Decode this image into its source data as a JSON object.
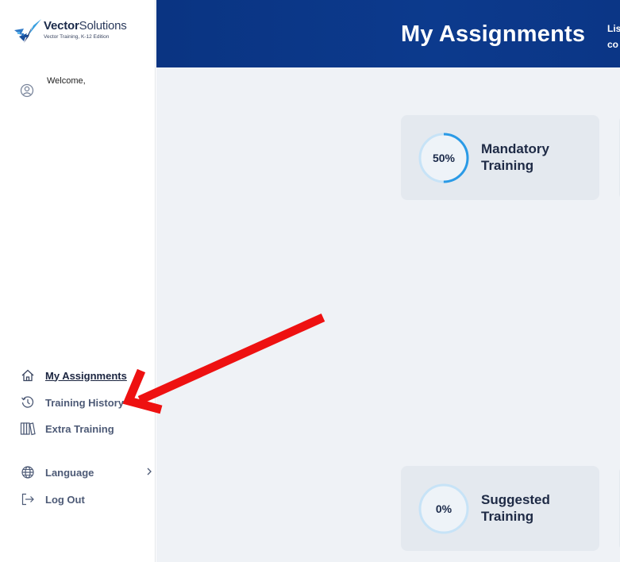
{
  "logo": {
    "brand_bold": "Vector",
    "brand_light": "Solutions",
    "edition": "Vector Training, K-12 Edition"
  },
  "sidebar": {
    "welcome": "Welcome,",
    "nav": [
      {
        "label": "My Assignments",
        "icon": "home-icon",
        "active": true
      },
      {
        "label": "Training History",
        "icon": "history-icon"
      },
      {
        "label": "Extra Training",
        "icon": "library-icon"
      }
    ],
    "language": "Language",
    "logout": "Log Out"
  },
  "header": {
    "title": "My Assignments",
    "sub_line1": "Lis",
    "sub_line2": "co"
  },
  "cards": [
    {
      "name": "Mandatory Training",
      "percent_label": "50%",
      "progress": 0.5
    },
    {
      "name": "Suggested Training",
      "percent_label": "0%",
      "progress": 0.0
    }
  ],
  "colors": {
    "header_bg": "#0b3686",
    "accent": "#2a9ae6",
    "ring_track": "#c7e3f7",
    "annotation_arrow": "#ee1111"
  }
}
